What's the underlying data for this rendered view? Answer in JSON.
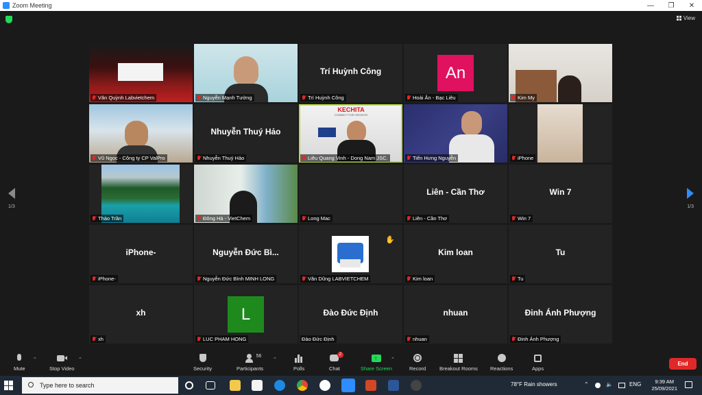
{
  "window": {
    "title": "Zoom Meeting",
    "minimize": "—",
    "maximize": "❐",
    "close": "✕"
  },
  "topbar": {
    "view_label": "View"
  },
  "pagination": {
    "left": "1/3",
    "right": "1/3"
  },
  "tiles": [
    {
      "label": "Văn Quỳnh Labvietchem",
      "display": ""
    },
    {
      "label": "Nguyễn Mạnh Tường",
      "display": ""
    },
    {
      "label": "Trí Huỳnh Công",
      "display": "Trí Huỳnh Công"
    },
    {
      "label": "Hoài Ân - Bạc Liêu",
      "display": "",
      "avatar_text": "An",
      "avatar_color": "#e0115f"
    },
    {
      "label": "Kim My",
      "display": ""
    },
    {
      "label": "Vũ Ngọc - Công ty CP ValPro",
      "display": ""
    },
    {
      "label": "Nhuyễn Thuý Hảo",
      "display": "Nhuyễn Thuý Hảo"
    },
    {
      "label": "Liêu Quang Vinh - Dong Nam JSC.",
      "display": "",
      "logo_text": "KECHITA",
      "logo_sub": "CONNECT FOR GROWTH"
    },
    {
      "label": "Tiến Hưng Nguyễn",
      "display": ""
    },
    {
      "label": "iPhone",
      "display": ""
    },
    {
      "label": "Thảo Trần",
      "display": ""
    },
    {
      "label": "Đông Hà - VietChem",
      "display": ""
    },
    {
      "label": "Long Mac",
      "display": ""
    },
    {
      "label": "Liên - Cần Thơ",
      "display": "Liên - Cần Thơ"
    },
    {
      "label": "Win 7",
      "display": "Win 7"
    },
    {
      "label": "iPhone-",
      "display": "iPhone-"
    },
    {
      "label": "Nguyễn Đức Bình MINH LONG",
      "display": "Nguyễn Đức Bì..."
    },
    {
      "label": "Văn Dũng LABVIETCHEM",
      "display": ""
    },
    {
      "label": "Kim loan",
      "display": "Kim loan"
    },
    {
      "label": "Tu",
      "display": "Tu"
    },
    {
      "label": "xh",
      "display": "xh"
    },
    {
      "label": "LUC PHAM HONG",
      "display": "",
      "avatar_text": "L",
      "avatar_color": "#1e8a1e"
    },
    {
      "label": "Đào Đức Định",
      "display": "Đào Đức Định"
    },
    {
      "label": "nhuan",
      "display": "nhuan"
    },
    {
      "label": "Đinh Ánh Phượng",
      "display": "Đinh Ánh Phượng"
    }
  ],
  "toolbar": {
    "mute": "Mute",
    "stop_video": "Stop Video",
    "security": "Security",
    "participants": "Participants",
    "participants_count": "56",
    "polls": "Polls",
    "chat": "Chat",
    "chat_badge": "2",
    "share_screen": "Share Screen",
    "record": "Record",
    "breakout_rooms": "Breakout Rooms",
    "reactions": "Reactions",
    "apps": "Apps",
    "end": "End"
  },
  "taskbar": {
    "search_placeholder": "Type here to search",
    "weather": "78°F Rain showers",
    "language": "ENG",
    "time": "9:39 AM",
    "date": "25/09/2021"
  },
  "colors": {
    "accent": "#2d8cff",
    "active_speaker": "#b8d94a",
    "end": "#e02828",
    "share": "#23d959"
  }
}
